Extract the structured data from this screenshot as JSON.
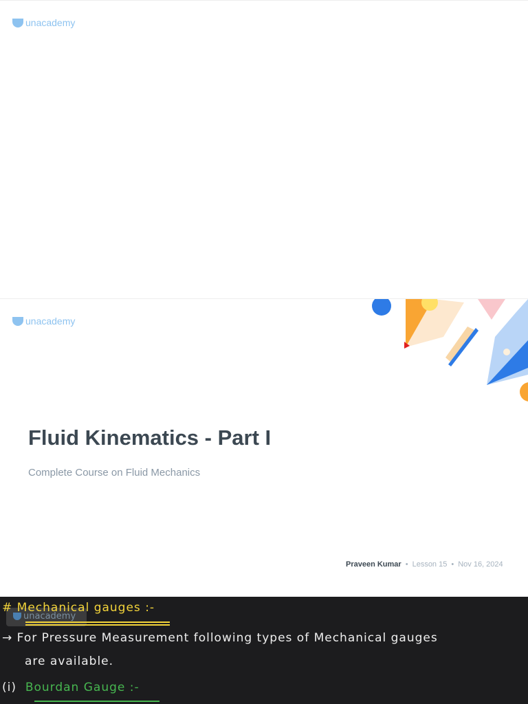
{
  "brand": "unacademy",
  "slide": {
    "title": "Fluid Kinematics - Part I",
    "subtitle": "Complete Course on Fluid Mechanics",
    "educator": "Praveen Kumar",
    "lesson": "Lesson 15",
    "date": "Nov 16, 2024",
    "separator": "•"
  },
  "notes": {
    "heading": "# Mechanical gauges :-",
    "line1": "→ For Pressure Measurement following types of Mechanical gauges",
    "line2": "are available.",
    "item_num": "(i)",
    "item_title": "Bourdan Gauge :-"
  },
  "colors": {
    "yellow": "#f3d43a",
    "green": "#47b650",
    "board": "#1c1c1e"
  }
}
